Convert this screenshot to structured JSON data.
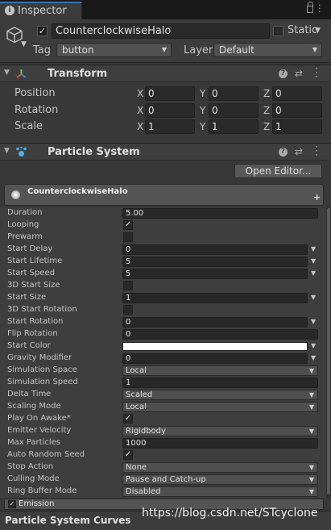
{
  "tab": {
    "label": "Inspector"
  },
  "header": {
    "name": "CounterclockwiseHalo",
    "static_label": "Static",
    "tag_label": "Tag",
    "tag_value": "button",
    "layer_label": "Layer",
    "layer_value": "Default"
  },
  "transform": {
    "title": "Transform",
    "rows": [
      {
        "label": "Position",
        "x": "0",
        "y": "0",
        "z": "0"
      },
      {
        "label": "Rotation",
        "x": "0",
        "y": "0",
        "z": "0"
      },
      {
        "label": "Scale",
        "x": "1",
        "y": "1",
        "z": "1"
      }
    ],
    "axis_x": "X",
    "axis_y": "Y",
    "axis_z": "Z"
  },
  "particle_system": {
    "title": "Particle System",
    "open_editor_label": "Open Editor...",
    "module_title": "CounterclockwiseHalo",
    "module_plus": "+",
    "properties": {
      "duration": {
        "label": "Duration",
        "value": "5.00"
      },
      "looping": {
        "label": "Looping",
        "checked": true
      },
      "prewarm": {
        "label": "Prewarm",
        "checked": false
      },
      "start_delay": {
        "label": "Start Delay",
        "value": "0"
      },
      "start_lifetime": {
        "label": "Start Lifetime",
        "value": "5"
      },
      "start_speed": {
        "label": "Start Speed",
        "value": "5"
      },
      "start_size_3d": {
        "label": "3D Start Size",
        "checked": false
      },
      "start_size": {
        "label": "Start Size",
        "value": "1"
      },
      "start_rotation_3d": {
        "label": "3D Start Rotation",
        "checked": false
      },
      "start_rotation": {
        "label": "Start Rotation",
        "value": "0"
      },
      "flip_rotation": {
        "label": "Flip Rotation",
        "value": "0"
      },
      "start_color": {
        "label": "Start Color",
        "color": "#ffffff"
      },
      "gravity_modifier": {
        "label": "Gravity Modifier",
        "value": "0"
      },
      "simulation_space": {
        "label": "Simulation Space",
        "value": "Local"
      },
      "simulation_speed": {
        "label": "Simulation Speed",
        "value": "1"
      },
      "delta_time": {
        "label": "Delta Time",
        "value": "Scaled"
      },
      "scaling_mode": {
        "label": "Scaling Mode",
        "value": "Local"
      },
      "play_on_awake": {
        "label": "Play On Awake*",
        "checked": true
      },
      "emitter_velocity": {
        "label": "Emitter Velocity",
        "value": "Rigidbody"
      },
      "max_particles": {
        "label": "Max Particles",
        "value": "1000"
      },
      "auto_random_seed": {
        "label": "Auto Random Seed",
        "checked": true
      },
      "stop_action": {
        "label": "Stop Action",
        "value": "None"
      },
      "culling_mode": {
        "label": "Culling Mode",
        "value": "Pause and Catch-up"
      },
      "ring_buffer_mode": {
        "label": "Ring Buffer Mode",
        "value": "Disabled"
      }
    },
    "emission_label": "Emission",
    "curves_title": "Particle System Curves"
  },
  "watermark": "https://blog.csdn.net/STcyclone",
  "colors": {
    "background": "#383838",
    "field": "#2a2a2a",
    "accent_tab": "#3a72b0"
  }
}
